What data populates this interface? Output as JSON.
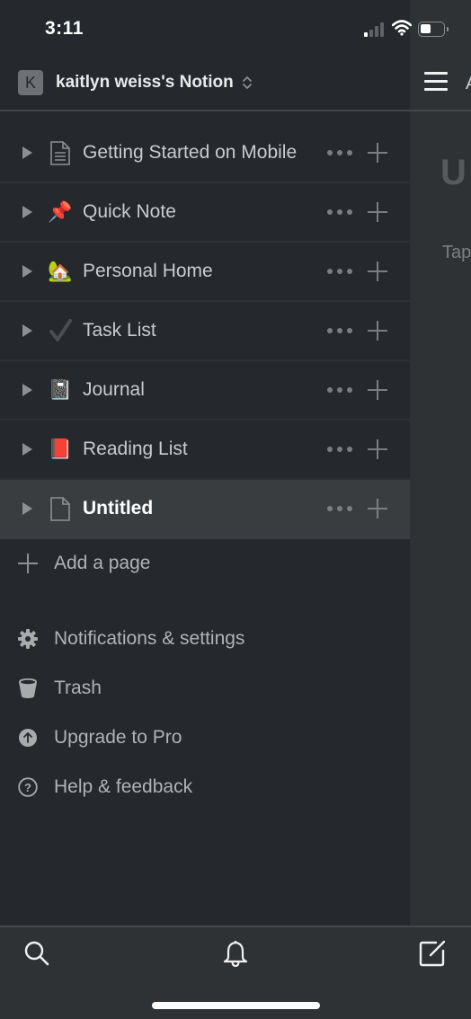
{
  "status_bar": {
    "time": "3:11",
    "signal_bars_on": 1,
    "signal_bars_total": 4,
    "battery_level": 0.4
  },
  "workspace": {
    "avatar_letter": "K",
    "name": "kaitlyn weiss's Notion",
    "switch_icon": "chevron-up-down-icon"
  },
  "pages": [
    {
      "icon": "📄",
      "icon_name": "document-icon",
      "title": "Getting Started on Mobile",
      "active": false
    },
    {
      "icon": "📌",
      "icon_name": "pushpin-icon",
      "title": "Quick Note",
      "active": false
    },
    {
      "icon": "🏡",
      "icon_name": "house-with-garden-icon",
      "title": "Personal Home",
      "active": false
    },
    {
      "icon": "✔",
      "icon_name": "check-mark-icon",
      "title": "Task List",
      "active": false
    },
    {
      "icon": "📓",
      "icon_name": "notebook-icon",
      "title": "Journal",
      "active": false
    },
    {
      "icon": "📕",
      "icon_name": "closed-book-icon",
      "title": "Reading List",
      "active": false
    },
    {
      "icon": "🗋",
      "icon_name": "blank-page-icon",
      "title": "Untitled",
      "active": true
    }
  ],
  "add_page": {
    "label": "Add a page"
  },
  "menu": [
    {
      "icon_name": "gear-icon",
      "label": "Notifications & settings"
    },
    {
      "icon_name": "trash-icon",
      "label": "Trash"
    },
    {
      "icon_name": "upgrade-arrow-icon",
      "label": "Upgrade to Pro"
    },
    {
      "icon_name": "help-icon",
      "label": "Help & feedback"
    }
  ],
  "main": {
    "breadcrumb_partial": "A",
    "title_partial": "U",
    "hint_partial": "Tap"
  },
  "bottom_bar": {
    "search_icon": "search-icon",
    "notifications_icon": "bell-icon",
    "compose_icon": "new-page-icon"
  },
  "colors": {
    "sidebar_bg": "#25282c",
    "main_bg": "#2f3235",
    "active_row_bg": "#3a3d40",
    "text": "#c9cbcd"
  }
}
